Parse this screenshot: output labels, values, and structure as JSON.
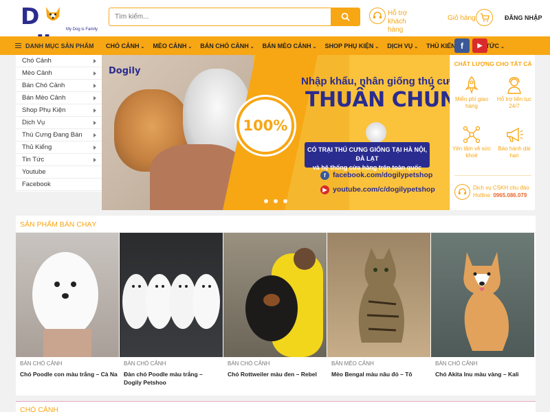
{
  "brand": {
    "name_prefix": "D",
    "name_suffix": "gily",
    "tagline": "My Dog is Family",
    "color": "#2b2c8f",
    "accent": "#f7a614"
  },
  "header": {
    "search_placeholder": "Tìm kiếm...",
    "support_line1": "Hỗ trợ",
    "support_line2": "khách hàng",
    "cart_label": "Giỏ hàng",
    "login_label": "ĐĂNG NHẬP"
  },
  "nav": {
    "category_label": "DANH MỤC SẢN PHẨM",
    "items": [
      "CHÓ CẢNH",
      "MÈO CẢNH",
      "BÁN CHÓ CẢNH",
      "BÁN MÈO CẢNH",
      "SHOP PHỤ KIỆN",
      "DỊCH VỤ",
      "THỦ KIỂNG",
      "TIN TỨC"
    ],
    "facebook_icon": "f",
    "youtube_icon": "▶"
  },
  "sidebar": {
    "items": [
      {
        "label": "Chó Cảnh",
        "has_sub": true
      },
      {
        "label": "Mèo Cảnh",
        "has_sub": true
      },
      {
        "label": "Bán Chó Cảnh",
        "has_sub": true
      },
      {
        "label": "Bán Mèo Cảnh",
        "has_sub": true
      },
      {
        "label": "Shop Phụ Kiện",
        "has_sub": true
      },
      {
        "label": "Dịch Vụ",
        "has_sub": true
      },
      {
        "label": "Thú Cưng Đang Bán",
        "has_sub": true
      },
      {
        "label": "Thủ Kiểng",
        "has_sub": true
      },
      {
        "label": "Tin Tức",
        "has_sub": true
      },
      {
        "label": "Youtube",
        "has_sub": false
      },
      {
        "label": "Facebook",
        "has_sub": false
      }
    ]
  },
  "banner": {
    "logo": "Dogily",
    "badge": "100%",
    "line1": "Nhập khẩu, nhân giống thú cưng",
    "line2": "THUẦN CHỦNG",
    "box_line1": "CÓ TRẠI THÚ CƯNG GIỐNG TẠI HÀ NỘI, ĐÀ LẠT",
    "box_line2": "và hệ thống cửa hàng trên toàn quốc",
    "facebook": "facebook.com/dogilypetshop",
    "youtube": "youtube.com/c/dogilypetshop"
  },
  "quality": {
    "title": "CHẤT LƯỢNG CHO TẤT CẢ",
    "features": [
      "Miễn phí giao hàng",
      "Hỗ trợ liên tục 24/7",
      "Yên tâm về sức khoẻ",
      "Bảo hành dài hạn"
    ],
    "support_title": "Dịch vụ CSKH chu đáo",
    "hotline_label": "Hotline:",
    "hotline": "0965.086.079"
  },
  "best_sellers": {
    "title": "SẢN PHẨM BÁN CHẠY",
    "products": [
      {
        "category": "BÁN CHÓ CẢNH",
        "name": "Chó Poodle con màu trắng – Cà Na"
      },
      {
        "category": "BÁN CHÓ CẢNH",
        "name": "Đàn chó Poodle màu trắng – Dogily Petshoo"
      },
      {
        "category": "BÁN CHÓ CẢNH",
        "name": "Chó Rottweiler màu đen – Rebel"
      },
      {
        "category": "BÁN MÈO CẢNH",
        "name": "Mèo Bengal màu nâu đỏ – Tô"
      },
      {
        "category": "BÁN CHÓ CẢNH",
        "name": "Chó Akita Inu màu vàng – Kali"
      }
    ]
  },
  "next_section": {
    "title": "CHÓ CẢNH"
  }
}
